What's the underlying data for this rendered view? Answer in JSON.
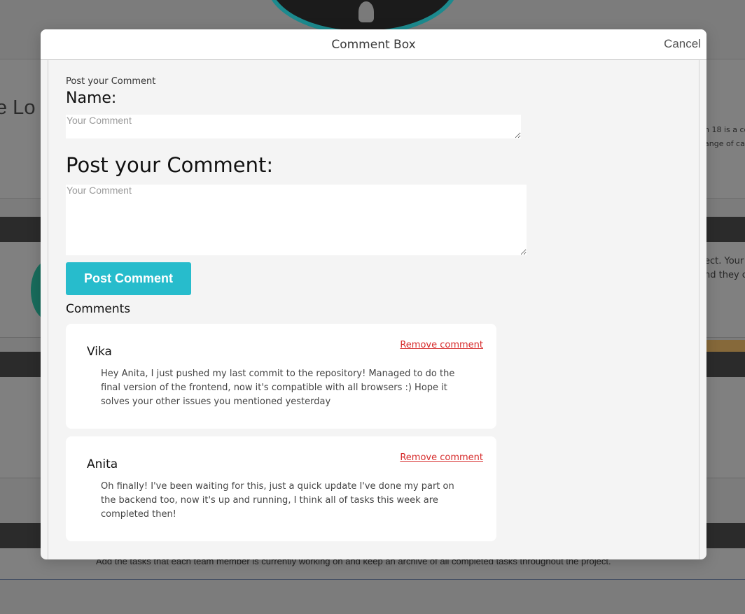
{
  "background": {
    "heading_fragment": "e Lo",
    "side_text_1": "n 18 is a co",
    "side_text_2": "ange of ca",
    "side_text_3": "ect. Your",
    "side_text_4": "nd they c",
    "footer_text": "Add the tasks that each team member is currently working on and keep an archive of all completed tasks throughout the project."
  },
  "modal": {
    "title": "Comment Box",
    "cancel_label": "Cancel"
  },
  "form": {
    "intro_label": "Post your Comment",
    "name_label": "Name:",
    "name_placeholder": "Your Comment",
    "comment_label": "Post your Comment:",
    "comment_placeholder": "Your Comment",
    "submit_label": "Post Comment"
  },
  "comments_section": {
    "heading": "Comments",
    "remove_label": "Remove comment",
    "items": [
      {
        "author": "Vika",
        "text": "Hey Anita, I just pushed my last commit to the repository! Managed to do the final version of the frontend, now it's compatible with all browsers :) Hope it solves your other issues you mentioned yesterday"
      },
      {
        "author": "Anita",
        "text": "Oh finally! I've been waiting for this, just a quick update I've done my part on the backend too, now it's up and running, I think all of tasks this week are completed then!"
      }
    ]
  },
  "colors": {
    "accent": "#27bccc",
    "danger": "#d62a2a",
    "overlay": "#7c7c7c"
  }
}
